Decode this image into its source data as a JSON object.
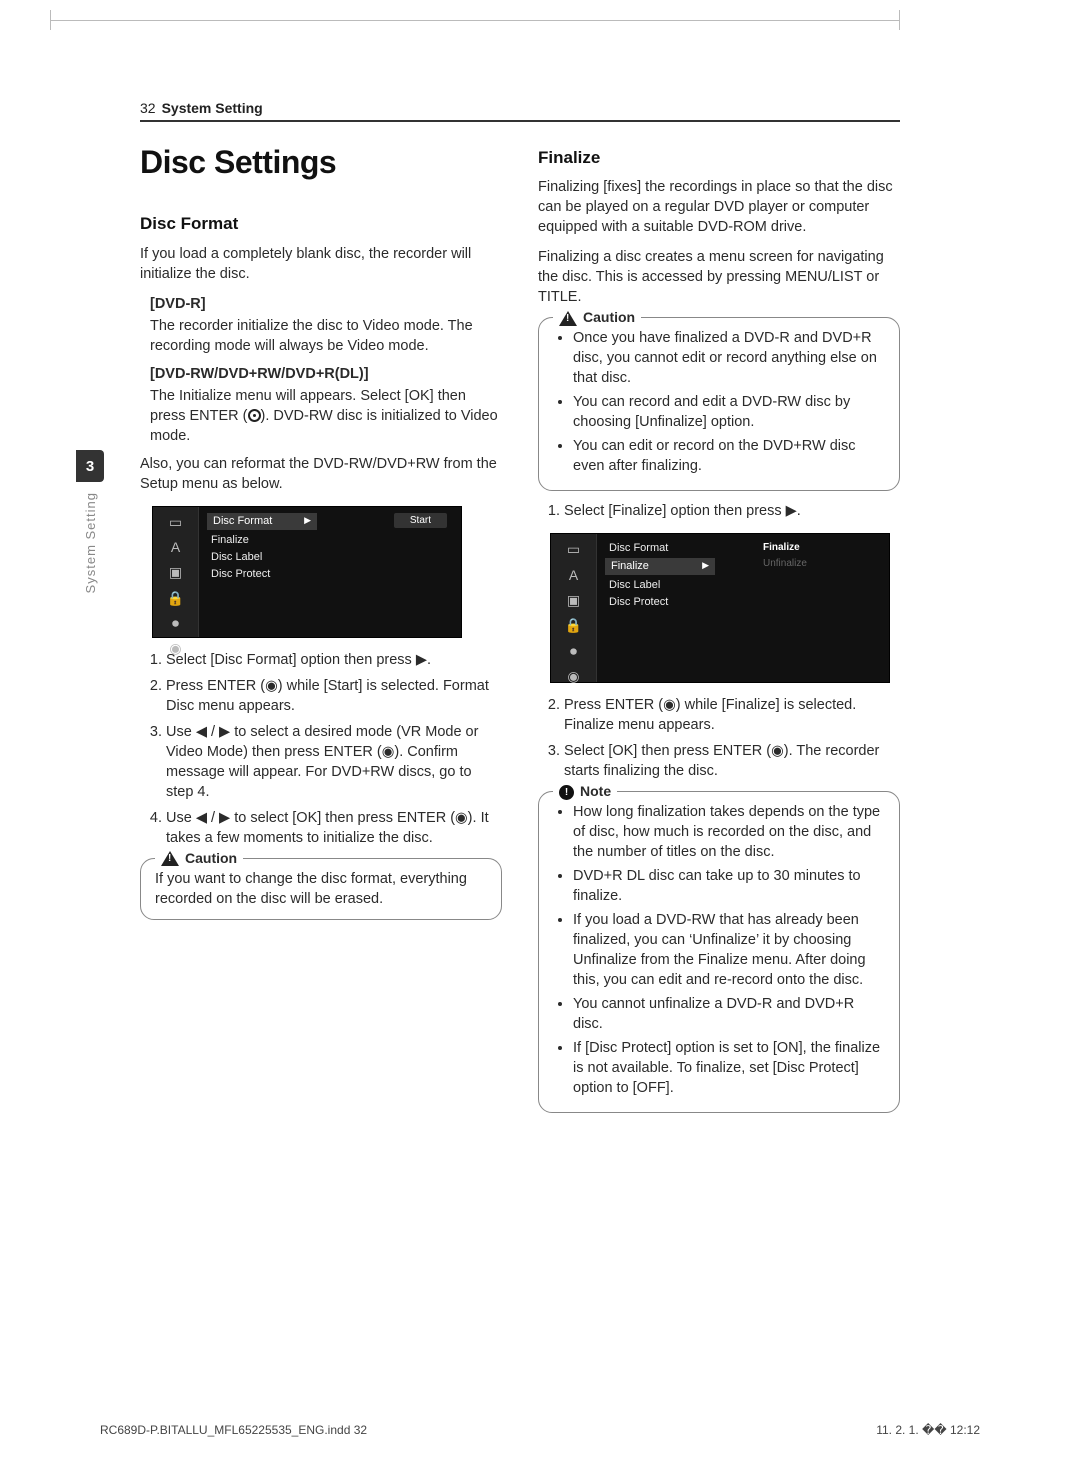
{
  "header": {
    "page_number": "32",
    "section": "System Setting"
  },
  "side_tab": {
    "chapter": "3",
    "label": "System Setting"
  },
  "left": {
    "h1": "Disc Settings",
    "h2_disc_format": "Disc Format",
    "intro": "If you load a completely blank disc, the recorder will initialize the disc.",
    "dvdr_title": "[DVD-R]",
    "dvdr_body": "The recorder initialize the disc to Video mode. The recording mode will always be Video mode.",
    "dvdrw_title": "[DVD-RW/DVD+RW/DVD+R(DL)]",
    "dvdrw_body_1": "The Initialize menu will appears. Select [OK] then press ENTER (",
    "dvdrw_body_2": "). DVD-RW disc is initialized to Video mode.",
    "also": "Also, you can reformat the DVD-RW/DVD+RW from the Setup menu as below.",
    "shot1": {
      "items": [
        "Disc Format",
        "Finalize",
        "Disc Label",
        "Disc Protect"
      ],
      "button": "Start"
    },
    "steps": [
      "Select [Disc Format] option then press ▶.",
      "Press ENTER (◉) while [Start] is selected. Format Disc menu appears.",
      "Use ◀ / ▶ to select a desired mode (VR Mode or Video Mode) then press ENTER (◉). Confirm message will appear. For DVD+RW discs, go to step 4.",
      "Use ◀ / ▶ to select [OK] then press ENTER (◉). It takes a few moments to initialize the disc."
    ],
    "caution_label": "Caution",
    "caution_body": "If you want to change the disc format, everything recorded on the disc will be erased."
  },
  "right": {
    "h2_finalize": "Finalize",
    "p1": "Finalizing [fixes] the recordings in place so that the disc can be played on a regular DVD player or computer equipped with a suitable DVD-ROM drive.",
    "p2": "Finalizing a disc creates a menu screen for navigating the disc. This is accessed by pressing MENU/LIST or TITLE.",
    "caution_label": "Caution",
    "caution_items": [
      "Once you have finalized a DVD-R and DVD+R disc, you cannot edit or record anything else on that disc.",
      "You can record and edit a DVD-RW disc by choosing [Unfinalize] option.",
      "You can edit or record on the DVD+RW disc even after finalizing."
    ],
    "step1": "Select [Finalize] option then press ▶.",
    "shot2": {
      "items": [
        "Disc Format",
        "Finalize",
        "Disc Label",
        "Disc Protect"
      ],
      "sub": [
        "Finalize",
        "Unfinalize"
      ]
    },
    "step2": "Press ENTER (◉) while [Finalize] is selected. Finalize menu appears.",
    "step3": "Select [OK] then press ENTER (◉). The recorder starts finalizing the disc.",
    "note_label": "Note",
    "note_items": [
      "How long finalization takes depends on the type of disc, how much is recorded on the disc, and the number of titles on the disc.",
      "DVD+R DL disc can take up to 30 minutes to finalize.",
      "If you load a DVD-RW that has already been finalized, you can ‘Unfinalize’ it by choosing Unfinalize from the Finalize menu. After doing this, you can edit and re-record onto the disc.",
      "You cannot unfinalize a DVD-R and DVD+R disc.",
      "If [Disc Protect] option is set to [ON], the finalize is not available. To finalize, set [Disc Protect] option to [OFF]."
    ]
  },
  "footer": {
    "left": "RC689D-P.BITALLU_MFL65225535_ENG.indd   32",
    "right": "11. 2. 1.   �� 12:12"
  }
}
